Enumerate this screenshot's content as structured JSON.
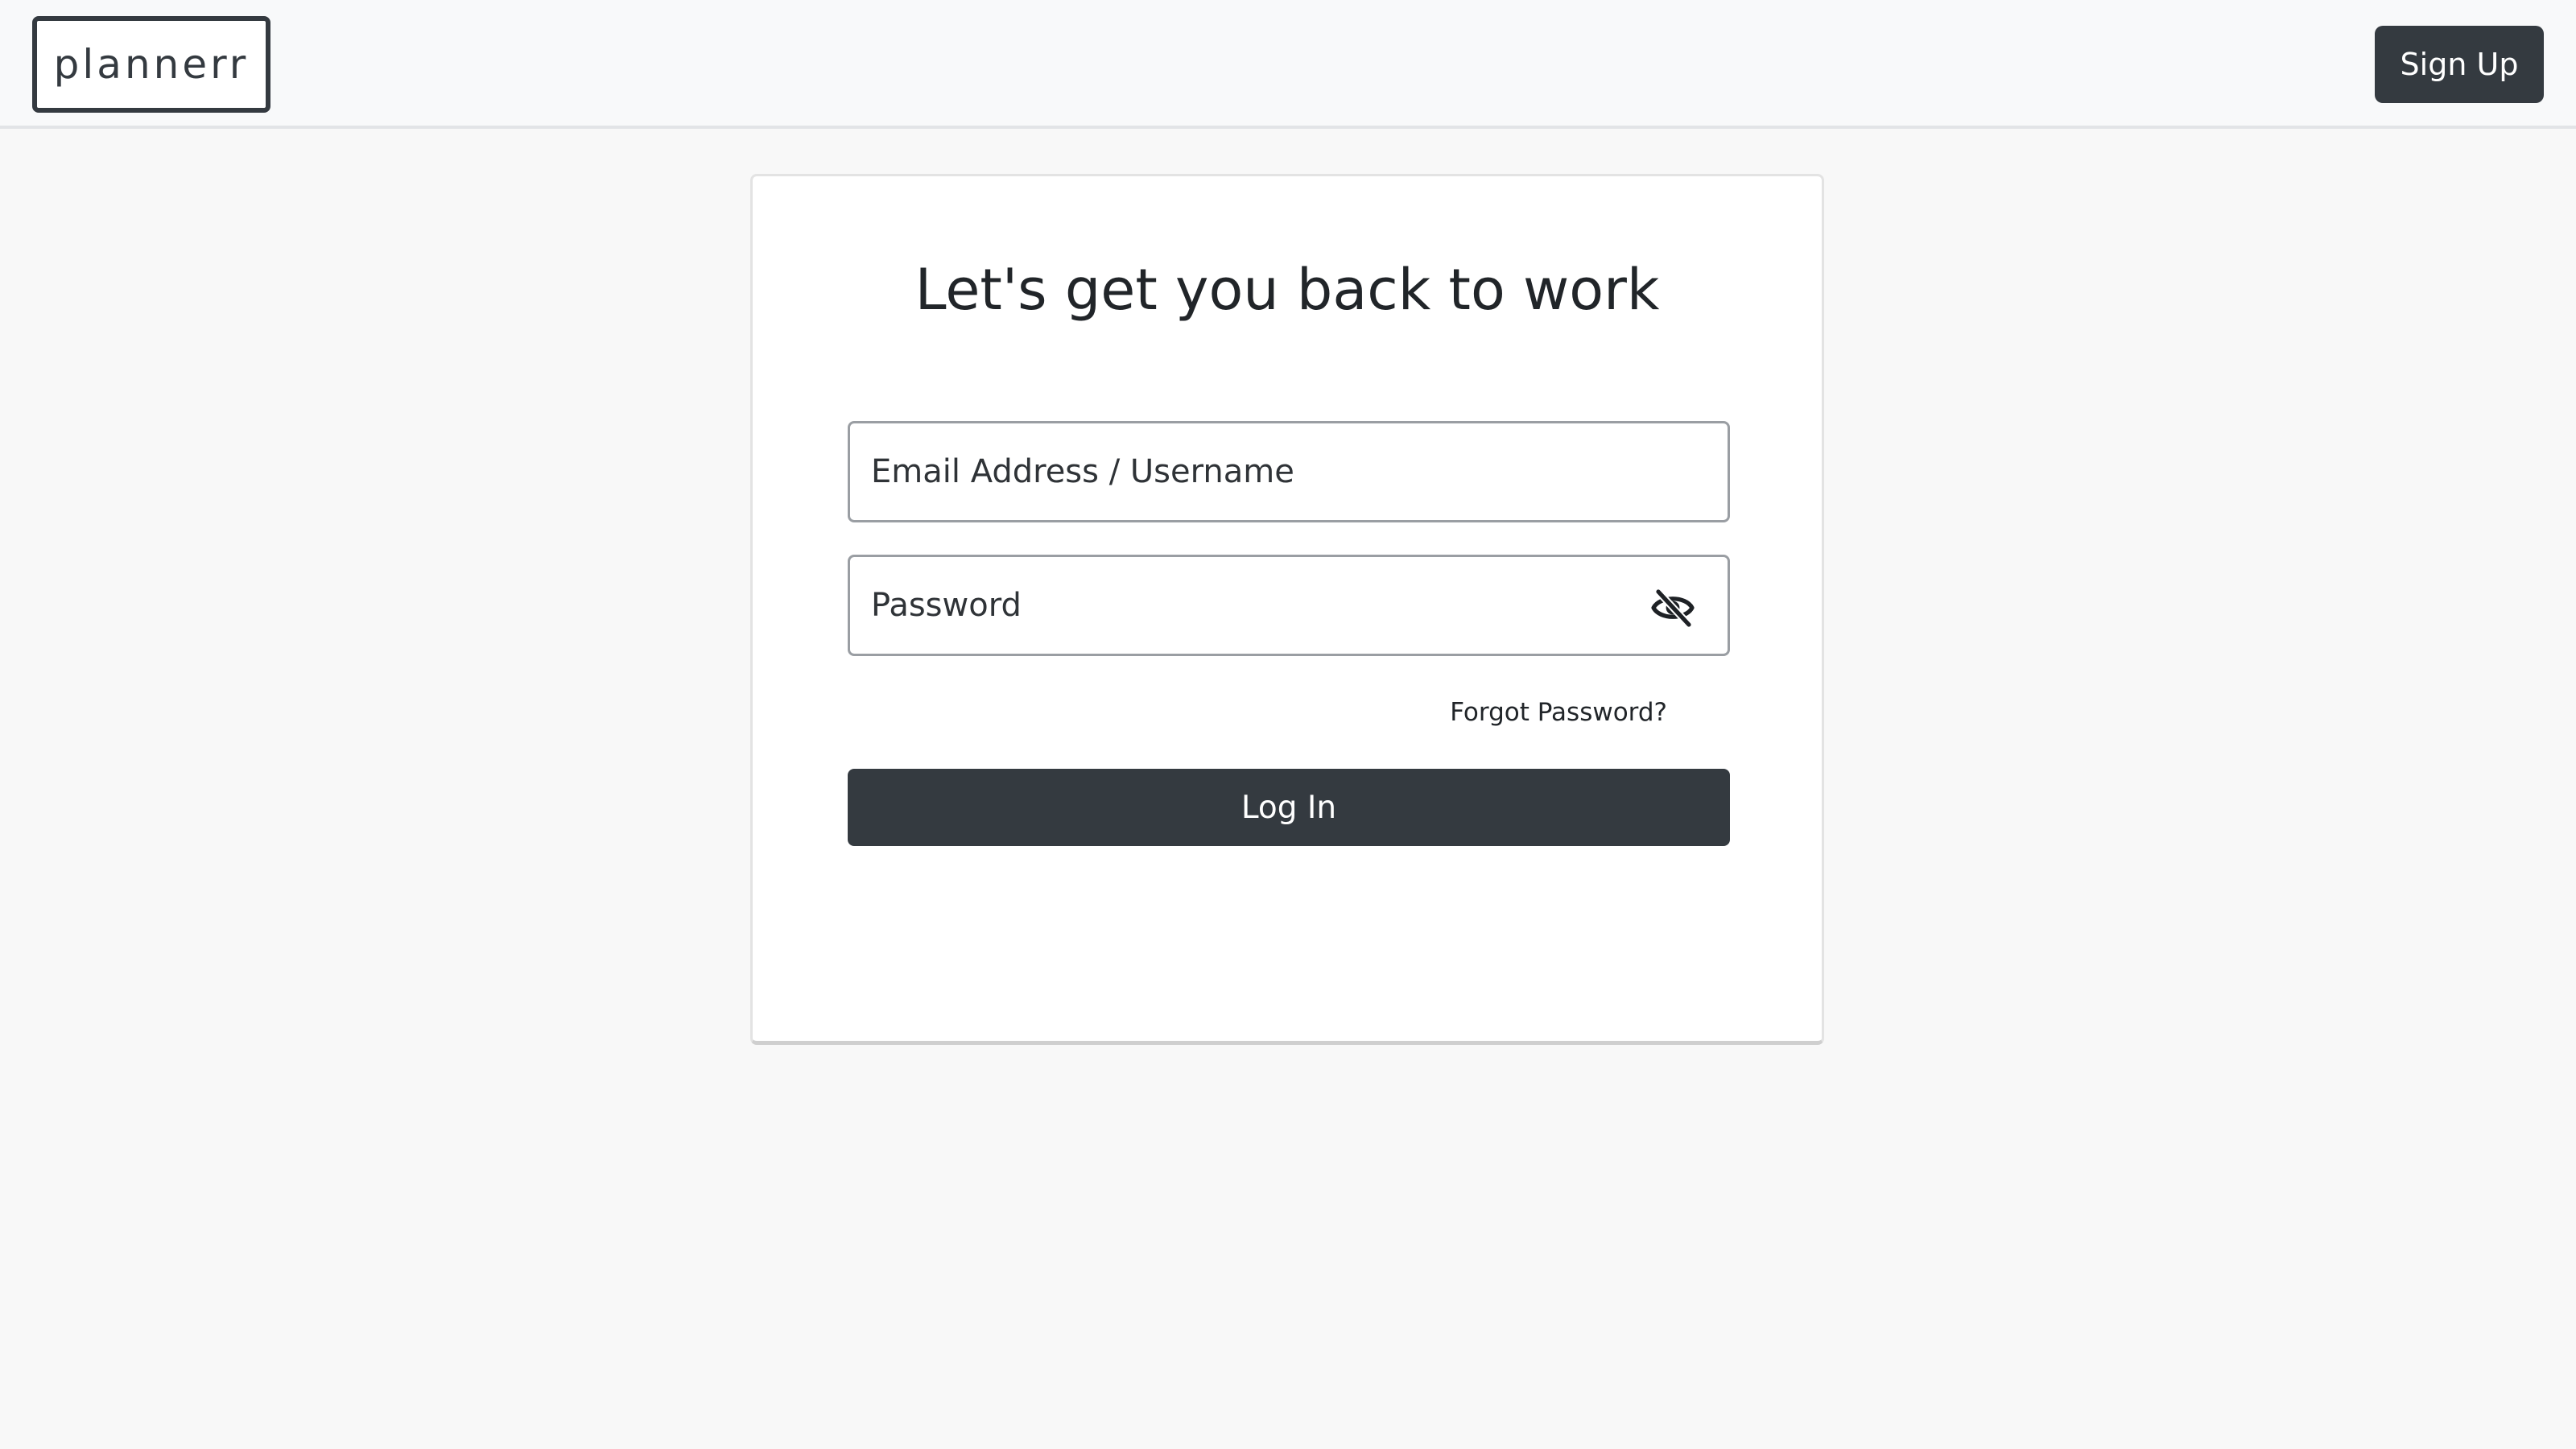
{
  "navbar": {
    "brand": "plannerr",
    "signup_label": "Sign Up"
  },
  "login": {
    "title": "Let's get you back to work",
    "email_placeholder": "Email Address / Username",
    "password_placeholder": "Password",
    "toggle_icon": "eye-slash-icon",
    "forgot_label": "Forgot Password?",
    "login_label": "Log In"
  },
  "colors": {
    "primary_dark": "#343a40",
    "page_background": "#f8f8f8",
    "navbar_background": "#f8f9fa",
    "card_background": "#ffffff"
  }
}
